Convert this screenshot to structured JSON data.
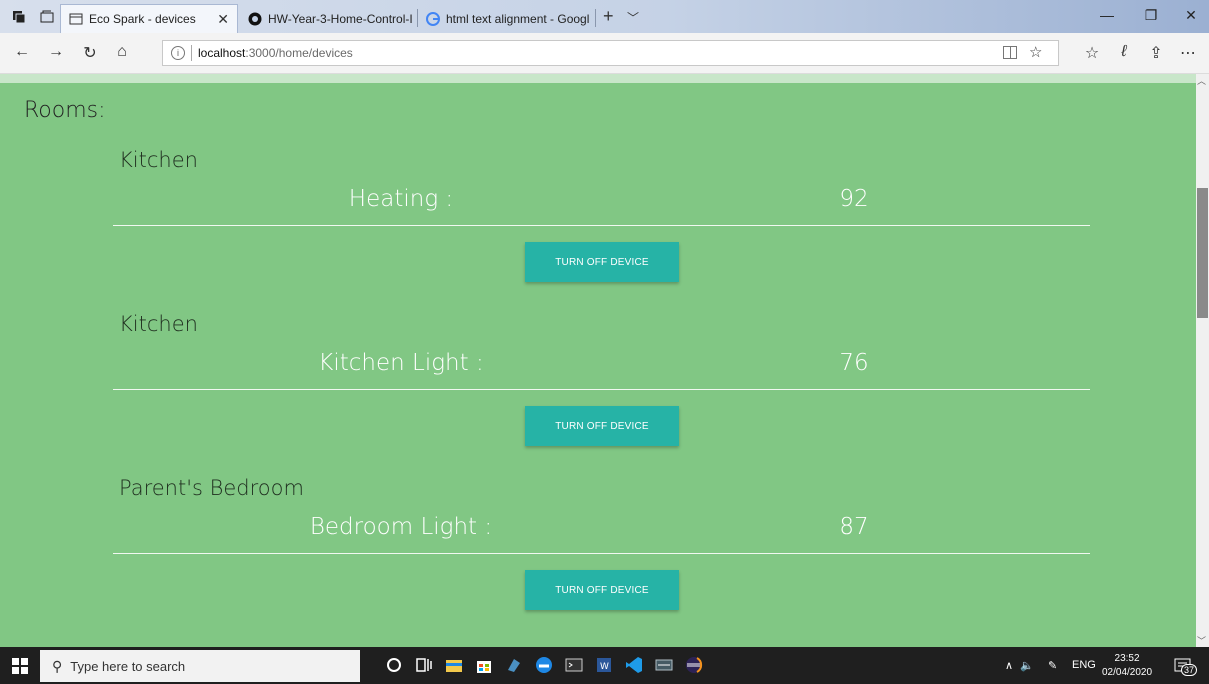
{
  "browser": {
    "tabs": [
      {
        "title": "Eco Spark - devices",
        "active": true,
        "icon": "page-icon"
      },
      {
        "title": "HW-Year-3-Home-Control-I",
        "active": false,
        "icon": "github-icon"
      },
      {
        "title": "html text alignment - Googl",
        "active": false,
        "icon": "google-icon"
      }
    ],
    "url_host": "localhost",
    "url_path": ":3000/home/devices"
  },
  "page": {
    "heading": "Rooms:",
    "devices": [
      {
        "room": "Kitchen",
        "name": "Heating :",
        "value": "92",
        "button": "TURN OFF DEVICE"
      },
      {
        "room": "Kitchen",
        "name": "Kitchen Light :",
        "value": "76",
        "button": "TURN OFF DEVICE"
      },
      {
        "room": "Parent's Bedroom",
        "name": "Bedroom Light :",
        "value": "87",
        "button": "TURN OFF DEVICE"
      }
    ]
  },
  "taskbar": {
    "search_placeholder": "Type here to search",
    "language": "ENG",
    "time": "23:52",
    "date": "02/04/2020",
    "notifications": "37"
  },
  "colors": {
    "page_bg": "#81c784",
    "button_bg": "#26b3a6",
    "heading_text": "#222222"
  }
}
